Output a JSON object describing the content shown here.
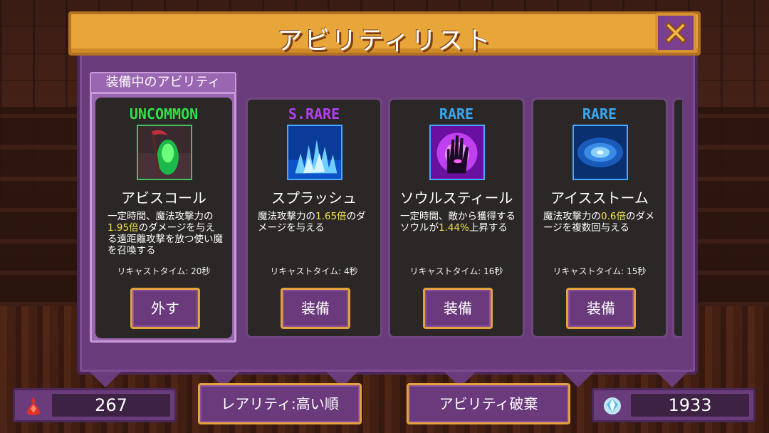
{
  "title": "アビリティリスト",
  "equipped_tab_label": "装備中のアビリティ",
  "colors": {
    "uncommon": "#2fe04a",
    "s_rare": "#b040f0",
    "rare": "#3aa6f2",
    "highlight": "#f2e34a"
  },
  "cards": [
    {
      "rarity": "UNCOMMON",
      "icon": "reaper-scythe-icon",
      "name": "アビスコール",
      "desc_parts": [
        "一定時間、魔法攻撃力の",
        "1.95倍",
        "のダメージを与える遠距離攻撃を放つ使い魔を召喚する"
      ],
      "recast": "リキャストタイム: 20秒",
      "button": "外す"
    },
    {
      "rarity": "S.RARE",
      "icon": "water-splash-icon",
      "name": "スプラッシュ",
      "desc_parts": [
        "魔法攻撃力の",
        "1.65倍",
        "のダメージを与える"
      ],
      "recast": "リキャストタイム: 4秒",
      "button": "装備"
    },
    {
      "rarity": "RARE",
      "icon": "soul-hand-icon",
      "name": "ソウルスティール",
      "desc_parts": [
        "一定時間、敵から獲得するソウルが",
        "1.44%",
        "上昇する"
      ],
      "recast": "リキャストタイム: 16秒",
      "button": "装備"
    },
    {
      "rarity": "RARE",
      "icon": "ice-storm-icon",
      "name": "アイスストーム",
      "desc_parts": [
        "魔法攻撃力の",
        "0.6倍",
        "のダメージを複数回与える"
      ],
      "recast": "リキャストタイム: 15秒",
      "button": "装備"
    }
  ],
  "bottom": {
    "soul_count": "267",
    "sort_button": "レアリティ:高い順",
    "discard_button": "アビリティ破棄",
    "gem_count": "1933"
  }
}
